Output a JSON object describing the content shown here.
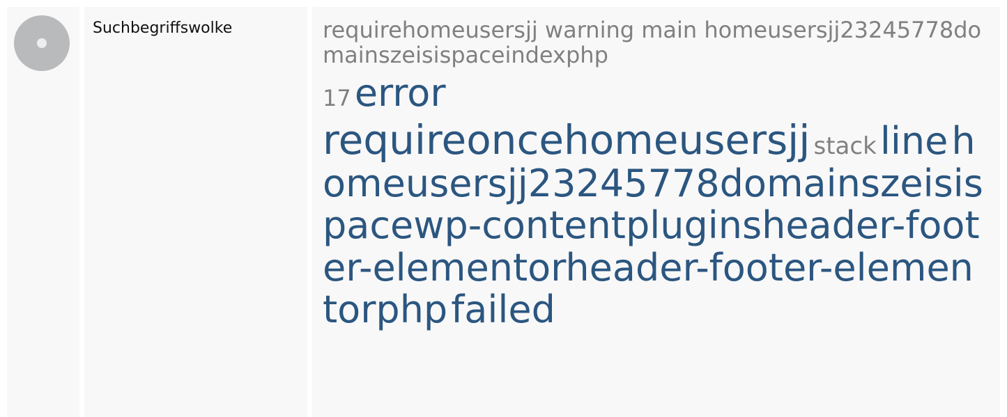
{
  "section": {
    "label": "Suchbegriffswolke"
  },
  "cloud": {
    "tags": [
      {
        "text": "requirehomeusersjj warning main homeusersjj23245778domainszeisispaceindexphp",
        "style": "gray"
      },
      {
        "text": "17",
        "style": "gray"
      },
      {
        "text": "error",
        "style": "blue"
      },
      {
        "text": "requireoncehomeusersjj",
        "style": "blue"
      },
      {
        "text": "stack",
        "style": "gray"
      },
      {
        "text": "line",
        "style": "blue"
      },
      {
        "text": "homeusersjj23245778domainszeisispacewp-contentpluginsheader-footer-elementorheader-footer-elementorphp",
        "style": "blue"
      },
      {
        "text": "failed",
        "style": "blue"
      }
    ]
  },
  "colors": {
    "panel_bg": "#f8f8f8",
    "tag_gray": "#808080",
    "tag_blue": "#2b5680",
    "icon_disc": "#b9babc"
  }
}
